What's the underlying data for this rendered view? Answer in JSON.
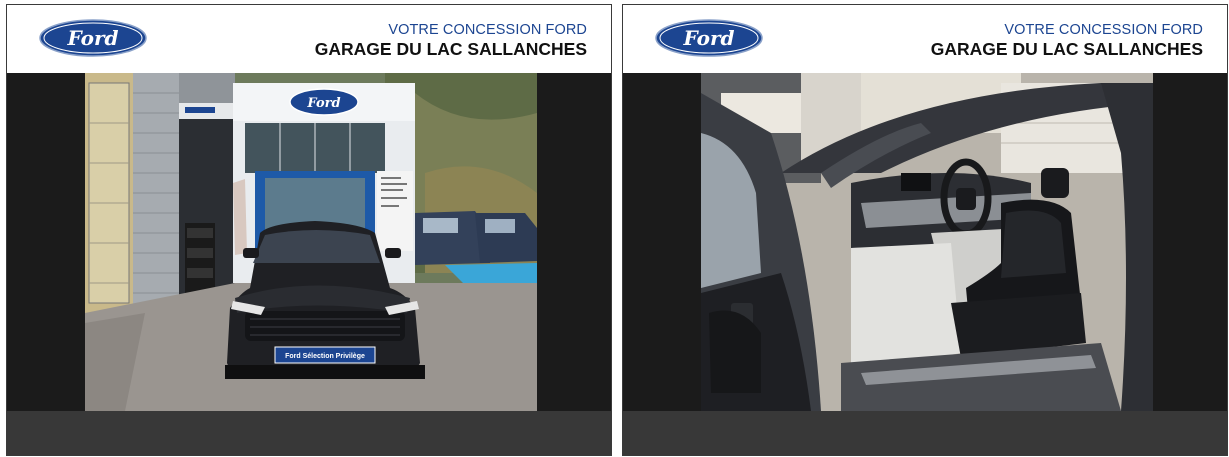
{
  "panels": [
    {
      "brand": "Ford",
      "dealer_subtitle": "VOTRE CONCESSION FORD",
      "dealer_name": "GARAGE DU LAC SALLANCHES",
      "photo": {
        "subject": "Ford Mustang Mach-E front view at dealership",
        "plate_text": "Ford Sélection Privilège",
        "building_sign": "Ford"
      }
    },
    {
      "brand": "Ford",
      "dealer_subtitle": "VOTRE CONCESSION FORD",
      "dealer_name": "GARAGE DU LAC SALLANCHES",
      "photo": {
        "subject": "Ford Mustang Mach-E driver side interior with open door"
      }
    }
  ],
  "colors": {
    "ford_blue": "#1c4591",
    "panel_bg": "#1b1b1b",
    "footer_bg": "#383838"
  }
}
